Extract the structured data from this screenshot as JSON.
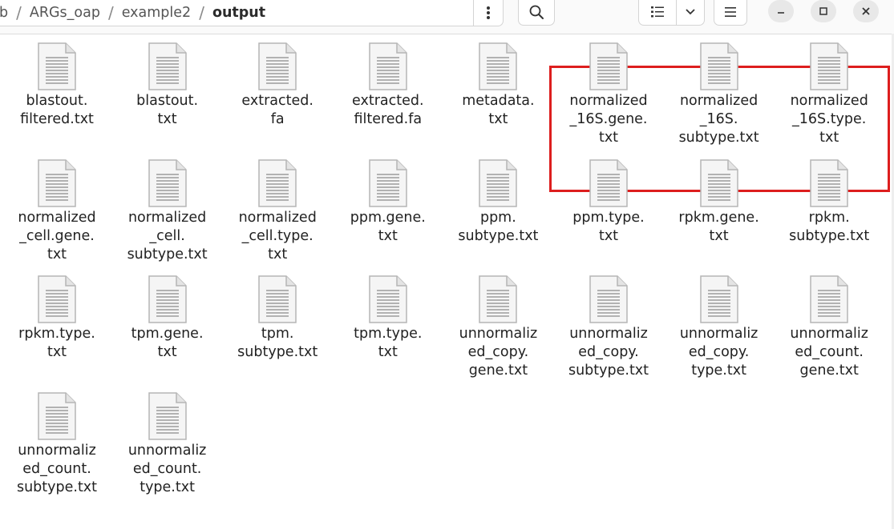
{
  "window": {
    "breadcrumb": [
      {
        "label": "b"
      },
      {
        "label": "ARGs_oap"
      },
      {
        "label": "example2"
      },
      {
        "label": "output",
        "current": true
      }
    ],
    "breadcrumb_separator": "/",
    "path_menu_icon": "vertical-dots-icon",
    "buttons": {
      "search": "search-icon",
      "view_list": "list-view-icon",
      "view_dropdown": "chevron-down-icon",
      "main_menu": "hamburger-menu-icon",
      "minimize": "minimize-icon",
      "maximize": "maximize-icon",
      "close": "close-icon"
    }
  },
  "files": [
    {
      "name": "blastout.\nfiltered.txt",
      "icon": "text-file-icon"
    },
    {
      "name": "blastout.\ntxt",
      "icon": "text-file-icon"
    },
    {
      "name": "extracted.\nfa",
      "icon": "text-file-icon"
    },
    {
      "name": "extracted.\nfiltered.fa",
      "icon": "text-file-icon"
    },
    {
      "name": "metadata.\ntxt",
      "icon": "text-file-icon"
    },
    {
      "name": "normalized\n_16S.gene.\ntxt",
      "icon": "text-file-icon"
    },
    {
      "name": "normalized\n_16S.\nsubtype.txt",
      "icon": "text-file-icon"
    },
    {
      "name": "normalized\n_16S.type.\ntxt",
      "icon": "text-file-icon"
    },
    {
      "name": "normalized\n_cell.gene.\ntxt",
      "icon": "text-file-icon"
    },
    {
      "name": "normalized\n_cell.\nsubtype.txt",
      "icon": "text-file-icon"
    },
    {
      "name": "normalized\n_cell.type.\ntxt",
      "icon": "text-file-icon"
    },
    {
      "name": "ppm.gene.\ntxt",
      "icon": "text-file-icon"
    },
    {
      "name": "ppm.\nsubtype.txt",
      "icon": "text-file-icon"
    },
    {
      "name": "ppm.type.\ntxt",
      "icon": "text-file-icon"
    },
    {
      "name": "rpkm.gene.\ntxt",
      "icon": "text-file-icon"
    },
    {
      "name": "rpkm.\nsubtype.txt",
      "icon": "text-file-icon"
    },
    {
      "name": "rpkm.type.\ntxt",
      "icon": "text-file-icon"
    },
    {
      "name": "tpm.gene.\ntxt",
      "icon": "text-file-icon"
    },
    {
      "name": "tpm.\nsubtype.txt",
      "icon": "text-file-icon"
    },
    {
      "name": "tpm.type.\ntxt",
      "icon": "text-file-icon"
    },
    {
      "name": "unnormaliz\ned_copy.\ngene.txt",
      "icon": "text-file-icon"
    },
    {
      "name": "unnormaliz\ned_copy.\nsubtype.txt",
      "icon": "text-file-icon"
    },
    {
      "name": "unnormaliz\ned_copy.\ntype.txt",
      "icon": "text-file-icon"
    },
    {
      "name": "unnormaliz\ned_count.\ngene.txt",
      "icon": "text-file-icon"
    },
    {
      "name": "unnormaliz\ned_count.\nsubtype.txt",
      "icon": "text-file-icon"
    },
    {
      "name": "unnormaliz\ned_count.\ntype.txt",
      "icon": "text-file-icon"
    }
  ],
  "annotation": {
    "highlight_color": "#dd1e1e"
  },
  "colors": {
    "text": "#222222",
    "header_bg": "#fafafa",
    "icon_fill": "#f5f5f5",
    "icon_stroke": "#b5b5b5"
  }
}
